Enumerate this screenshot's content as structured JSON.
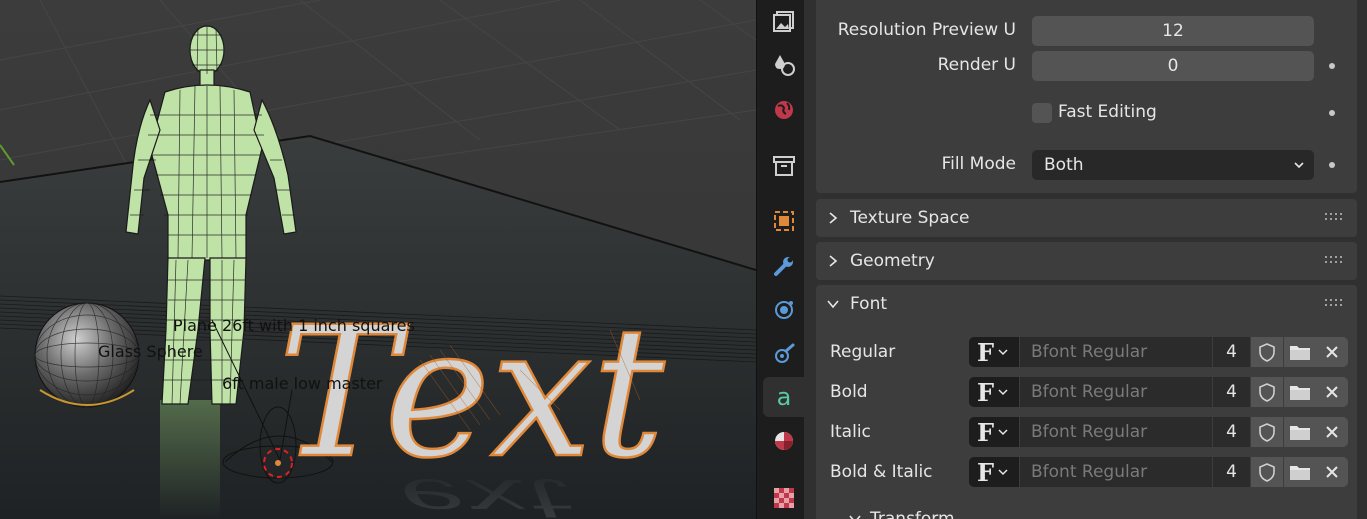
{
  "viewport": {
    "object_labels": [
      "Plane 26ft with 1 inch squares",
      "Glass Sphere",
      "6ft male low master"
    ],
    "text_object": "Text"
  },
  "tabs": [
    {
      "icon": "render-output-icon",
      "active": false
    },
    {
      "icon": "view-layer-icon",
      "active": false
    },
    {
      "icon": "world-icon",
      "active": false
    },
    {
      "icon": "collection-icon",
      "active": false
    },
    {
      "icon": "object-icon",
      "active": false
    },
    {
      "icon": "modifier-wrench-icon",
      "active": false
    },
    {
      "icon": "particles-icon",
      "active": false
    },
    {
      "icon": "physics-icon",
      "active": false
    },
    {
      "icon": "text-data-icon",
      "active": true
    },
    {
      "icon": "material-icon",
      "active": false
    },
    {
      "icon": "texture-icon",
      "active": false
    }
  ],
  "shape": {
    "resolution_preview_u": {
      "label": "Resolution Preview U",
      "value": "12"
    },
    "render_u": {
      "label": "Render U",
      "value": "0"
    },
    "fast_editing": {
      "label": "Fast Editing",
      "checked": false
    },
    "fill_mode": {
      "label": "Fill Mode",
      "value": "Both"
    }
  },
  "panels": {
    "texture_space": "Texture Space",
    "geometry": "Geometry",
    "font": "Font",
    "transform": "Transform"
  },
  "font": {
    "rows": [
      {
        "label": "Regular",
        "font_name": "Bfont Regular",
        "users": "4"
      },
      {
        "label": "Bold",
        "font_name": "Bfont Regular",
        "users": "4"
      },
      {
        "label": "Italic",
        "font_name": "Bfont Regular",
        "users": "4"
      },
      {
        "label": "Bold & Italic",
        "font_name": "Bfont Regular",
        "users": "4"
      }
    ],
    "picker_glyph": "F"
  },
  "colors": {
    "accent_orange": "#e0883a",
    "active_text_icon": "#58c8a8",
    "panel_bg": "#3d3d3d",
    "editor_bg": "#303030"
  }
}
